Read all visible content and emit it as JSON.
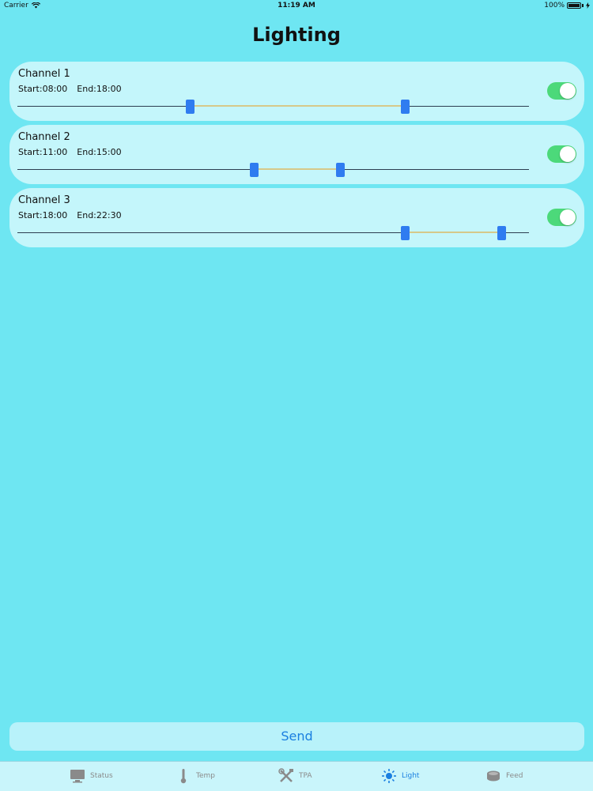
{
  "status_bar": {
    "carrier": "Carrier",
    "time": "11:19 AM",
    "battery": "100%"
  },
  "title": "Lighting",
  "channels": [
    {
      "name": "Channel 1",
      "start": "Start:08:00",
      "end": "End:18:00",
      "enabled": true,
      "range_start_fraction": 0.333,
      "range_end_fraction": 0.75
    },
    {
      "name": "Channel 2",
      "start": "Start:11:00",
      "end": "End:15:00",
      "enabled": true,
      "range_start_fraction": 0.458,
      "range_end_fraction": 0.625
    },
    {
      "name": "Channel 3",
      "start": "Start:18:00",
      "end": "End:22:30",
      "enabled": true,
      "range_start_fraction": 0.75,
      "range_end_fraction": 0.9375
    }
  ],
  "send_label": "Send",
  "tabs": [
    {
      "label": "Status",
      "icon": "monitor-icon",
      "active": false
    },
    {
      "label": "Temp",
      "icon": "thermometer-icon",
      "active": false
    },
    {
      "label": "TPA",
      "icon": "tools-icon",
      "active": false
    },
    {
      "label": "Light",
      "icon": "sun-icon",
      "active": true
    },
    {
      "label": "Feed",
      "icon": "feeder-icon",
      "active": false
    }
  ],
  "colors": {
    "background": "#6ee6f2",
    "card": "#c4f6fb",
    "accent": "#1a7fe0",
    "thumb": "#2f7cf0",
    "toggle_on": "#4cd97a",
    "range": "#d6c98a"
  }
}
